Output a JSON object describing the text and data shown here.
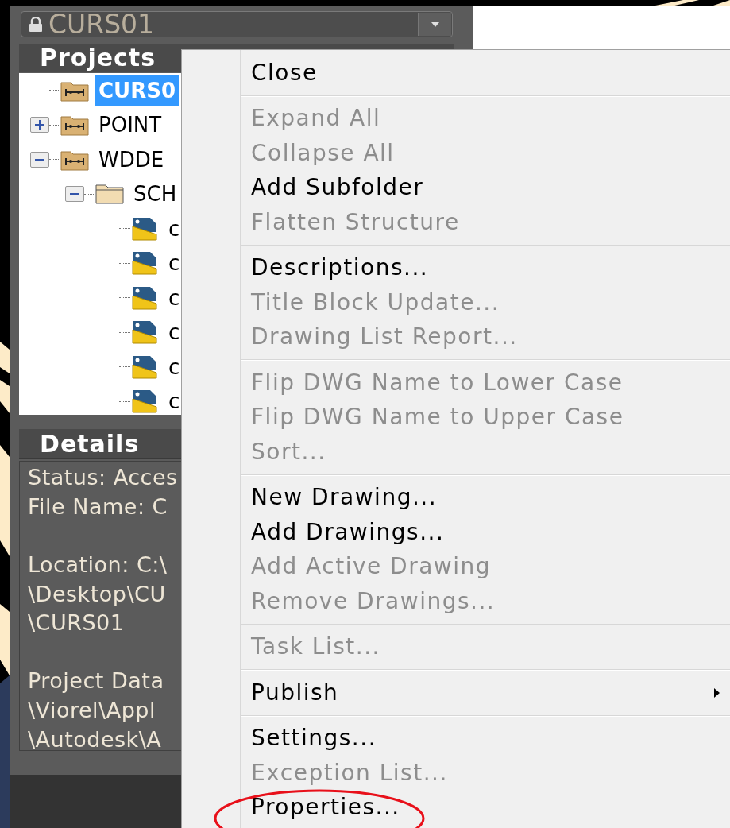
{
  "project_selector": {
    "value": "CURS01"
  },
  "projects_panel": {
    "title": "Projects",
    "tree": [
      {
        "label": "CURS0",
        "kind": "project",
        "selected": true
      },
      {
        "label": "POINT",
        "kind": "project",
        "selected": false,
        "expanded": false
      },
      {
        "label": "WDDE",
        "kind": "project",
        "selected": false,
        "expanded": true,
        "children": [
          {
            "label": "SCH",
            "kind": "folder",
            "selected": false,
            "expanded": true,
            "children": [
              {
                "label": "c",
                "kind": "drawing",
                "selected": false
              },
              {
                "label": "c",
                "kind": "drawing",
                "selected": false
              },
              {
                "label": "c",
                "kind": "drawing",
                "selected": false
              },
              {
                "label": "c",
                "kind": "drawing",
                "selected": false
              },
              {
                "label": "c",
                "kind": "drawing",
                "selected": false
              },
              {
                "label": "c",
                "kind": "drawing",
                "selected": false
              }
            ]
          }
        ]
      }
    ]
  },
  "details_panel": {
    "title": "Details",
    "paragraphs": [
      [
        "Status: Acces",
        "File Name: C"
      ],
      [
        "Location: C:\\",
        "\\Desktop\\CU",
        "\\CURS01"
      ],
      [
        "Project Data",
        "\\Viorel\\Appl",
        "\\Autodesk\\A"
      ]
    ]
  },
  "context_menu": {
    "groups": [
      {
        "items": [
          {
            "label": "Close",
            "disabled": false
          }
        ]
      },
      {
        "items": [
          {
            "label": "Expand All",
            "disabled": true
          },
          {
            "label": "Collapse All",
            "disabled": true
          },
          {
            "label": "Add Subfolder",
            "disabled": false
          },
          {
            "label": "Flatten Structure",
            "disabled": true
          }
        ]
      },
      {
        "items": [
          {
            "label": "Descriptions...",
            "disabled": false
          },
          {
            "label": "Title Block Update...",
            "disabled": true
          },
          {
            "label": "Drawing List Report...",
            "disabled": true
          }
        ]
      },
      {
        "items": [
          {
            "label": "Flip DWG Name to Lower Case",
            "disabled": true
          },
          {
            "label": "Flip DWG Name to Upper Case",
            "disabled": true
          },
          {
            "label": "Sort...",
            "disabled": true
          }
        ]
      },
      {
        "items": [
          {
            "label": "New Drawing...",
            "disabled": false
          },
          {
            "label": "Add Drawings...",
            "disabled": false
          },
          {
            "label": "Add Active Drawing",
            "disabled": true
          },
          {
            "label": "Remove Drawings...",
            "disabled": true
          }
        ]
      },
      {
        "items": [
          {
            "label": "Task List...",
            "disabled": true
          }
        ]
      },
      {
        "items": [
          {
            "label": "Publish",
            "disabled": false,
            "submenu": true
          }
        ]
      },
      {
        "items": [
          {
            "label": "Settings...",
            "disabled": false
          },
          {
            "label": "Exception List...",
            "disabled": true
          },
          {
            "label": "Properties...",
            "disabled": false
          }
        ]
      }
    ]
  }
}
